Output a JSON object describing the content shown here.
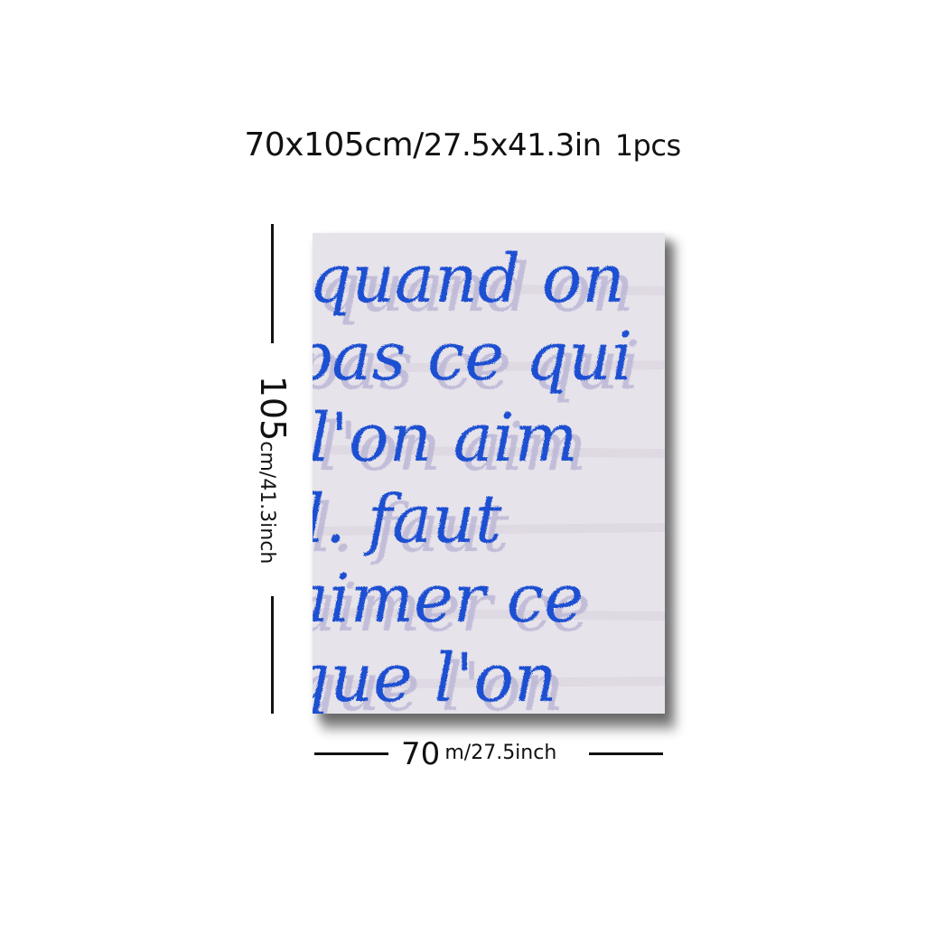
{
  "header": {
    "size_cm": "70x105cm/",
    "size_in": "27.5x41.3in",
    "quantity": "1pcs"
  },
  "dimensions": {
    "height_value": "105",
    "height_units": "cm/41.3inch",
    "width_value": "70",
    "width_units": "m/27.5inch"
  },
  "poster": {
    "handwritten_lines": [
      "quand on",
      "pas ce qui",
      "l'on aim",
      "l. faut",
      "aimer ce",
      "que l'on"
    ],
    "ink_color": "#1f4fd1",
    "background_color": "#e7e3ea"
  }
}
